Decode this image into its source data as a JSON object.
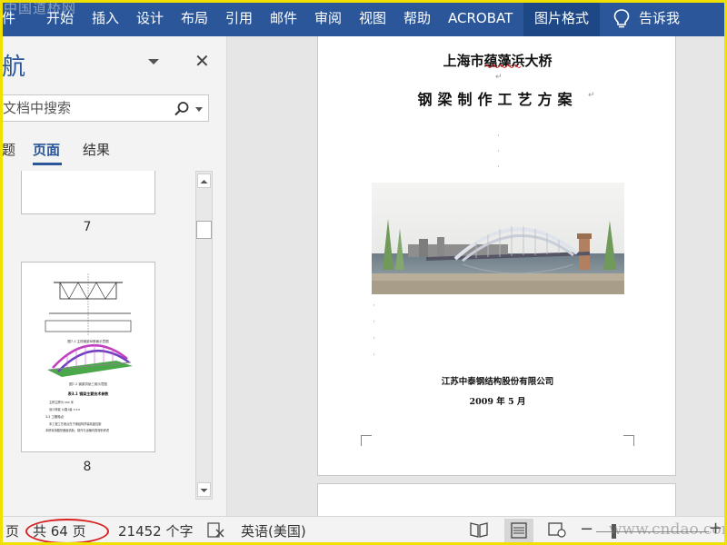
{
  "ribbon": {
    "watermark": "中国道桥网",
    "tabs": [
      {
        "label": "件"
      },
      {
        "label": "开始"
      },
      {
        "label": "插入"
      },
      {
        "label": "设计"
      },
      {
        "label": "布局"
      },
      {
        "label": "引用"
      },
      {
        "label": "邮件"
      },
      {
        "label": "审阅"
      },
      {
        "label": "视图"
      },
      {
        "label": "帮助"
      },
      {
        "label": "ACROBAT"
      },
      {
        "label": "图片格式"
      }
    ],
    "tell_me": "告诉我",
    "bg_color": "#2b579a"
  },
  "nav": {
    "title": "航",
    "search_placeholder": "文档中搜索",
    "tabs": [
      "题",
      "页面",
      "结果"
    ],
    "thumbs": [
      {
        "number": "7"
      },
      {
        "number": "8",
        "content": {
          "caption1": "图7-1 主桥钢梁纵断面示意图",
          "caption2": "图7-2 钢梁拱肋三维示意图",
          "heading": "表3.1 钢梁主要技术参数",
          "lines": [
            "主桥主跨为 xxx 米",
            "设计荷载 公路-I级 ×××",
            "3.2 工程特点",
            "本工程工艺难点在于钢结构拼装精度控制",
            "本桥采用箱形截面拱肋，制作与运输均需特别考虑"
          ]
        }
      }
    ]
  },
  "document": {
    "title": "上海市蕴藻浜大桥",
    "subtitle": "钢梁制作工艺方案",
    "company": "江苏中泰钢结构股份有限公司",
    "date": "2009 年 5 月"
  },
  "status": {
    "page": "页",
    "page_count": "共 64 页",
    "word_count": "21452 个字",
    "language": "英语(美国)",
    "watermark": "www.cndao.com"
  }
}
